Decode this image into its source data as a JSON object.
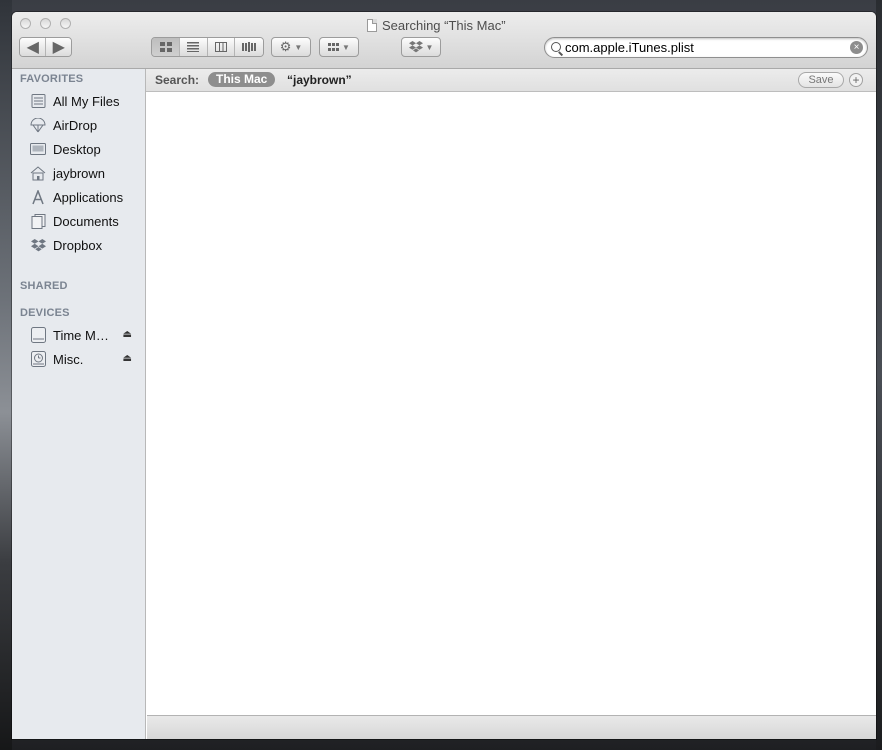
{
  "window": {
    "title": "Searching “This Mac”"
  },
  "toolbar": {
    "back_icon": "chevron-left-icon",
    "forward_icon": "chevron-right-icon",
    "view_modes": [
      "icon-view",
      "list-view",
      "column-view",
      "coverflow-view"
    ],
    "active_view": "icon-view",
    "action_icon": "gear-icon",
    "arrange_icon": "grid-icon",
    "dropbox_icon": "dropbox-icon",
    "search_value": "com.apple.iTunes.plist"
  },
  "sidebar": {
    "favorites_header": "FAVORITES",
    "favorites": [
      {
        "label": "All My Files",
        "icon": "all-files-icon"
      },
      {
        "label": "AirDrop",
        "icon": "airdrop-icon"
      },
      {
        "label": "Desktop",
        "icon": "desktop-icon"
      },
      {
        "label": "jaybrown",
        "icon": "home-icon"
      },
      {
        "label": "Applications",
        "icon": "applications-icon"
      },
      {
        "label": "Documents",
        "icon": "documents-icon"
      },
      {
        "label": "Dropbox",
        "icon": "dropbox-icon"
      }
    ],
    "shared_header": "SHARED",
    "devices_header": "DEVICES",
    "devices": [
      {
        "label": "Time M…",
        "icon": "drive-icon",
        "eject": true
      },
      {
        "label": "Misc.",
        "icon": "time-machine-icon",
        "eject": true
      }
    ]
  },
  "searchbar": {
    "label": "Search:",
    "scope_selected": "This Mac",
    "scope_other": "“jaybrown”",
    "save_label": "Save",
    "add_label": "+"
  },
  "colors": {
    "sidebar_bg": "#e7eaee",
    "section_header": "#7b8491",
    "scope_pill": "#8e8e8e"
  }
}
